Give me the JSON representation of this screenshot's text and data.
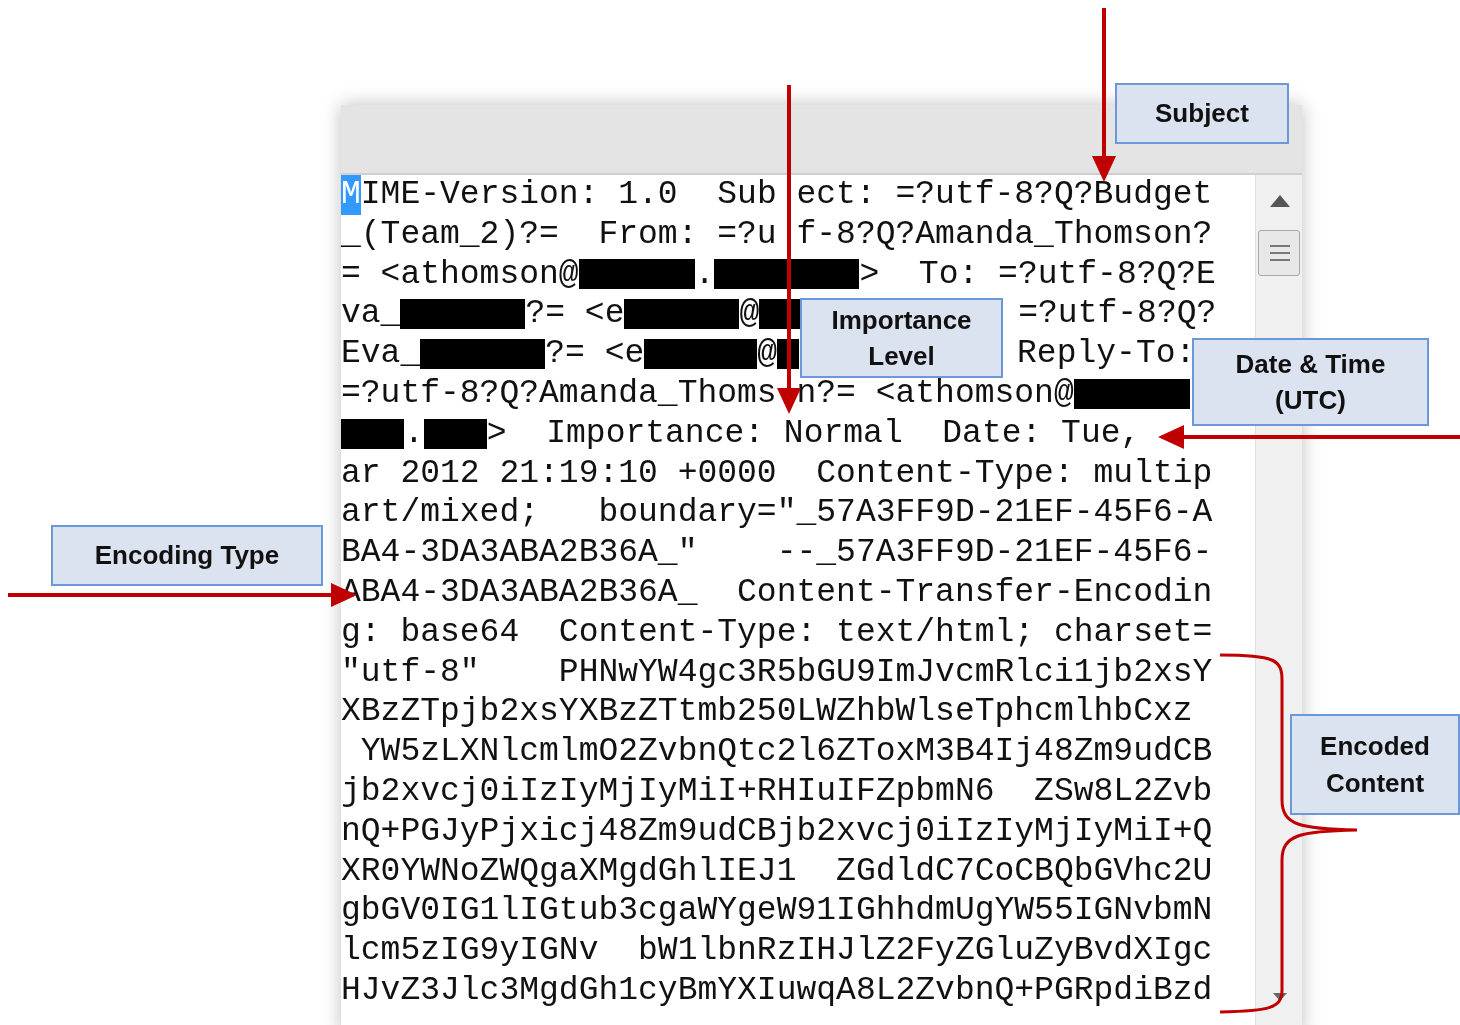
{
  "editor": {
    "lines": [
      {
        "segments": [
          {
            "text": "M",
            "highlighted": true
          },
          {
            "text": "IME-Version: 1.0  Sub",
            "highlighted": false
          },
          {
            "kind": "covered"
          },
          {
            "text": "ect: =?utf-8?Q?Budget"
          }
        ]
      },
      {
        "segments": [
          {
            "text": "_(Team_2)?=  From: =?u"
          },
          {
            "kind": "covered"
          },
          {
            "text": "f-8?Q?Amanda_Thomson?"
          }
        ]
      },
      {
        "segments": [
          {
            "text": "= <athomson@"
          },
          {
            "kind": "redacted"
          },
          {
            "text": "."
          },
          {
            "kind": "redacted"
          },
          {
            "text": ">  To: =?utf-8?Q?E"
          }
        ]
      },
      {
        "segments": [
          {
            "text": "va_"
          },
          {
            "kind": "redacted"
          },
          {
            "text": "?= <e"
          },
          {
            "kind": "redacted"
          },
          {
            "text": "@"
          },
          {
            "kind": "redacted"
          },
          {
            "kind": "hidden"
          },
          {
            "text": "=?utf-8?Q?"
          }
        ]
      },
      {
        "segments": [
          {
            "text": "Eva_"
          },
          {
            "kind": "redacted"
          },
          {
            "text": "?= <e"
          },
          {
            "kind": "redacted"
          },
          {
            "text": "@"
          },
          {
            "kind": "redacted"
          },
          {
            "kind": "hidden"
          },
          {
            "text": "Reply-To:"
          }
        ]
      },
      {
        "segments": [
          {
            "text": "=?utf-8?Q?Amanda_Thoms"
          },
          {
            "kind": "covered"
          },
          {
            "text": "n?= <athomson@"
          },
          {
            "kind": "redacted"
          }
        ]
      },
      {
        "segments": [
          {
            "kind": "redacted"
          },
          {
            "text": "."
          },
          {
            "kind": "redacted"
          },
          {
            "text": ">  Importance: Normal  Date: Tue,"
          }
        ]
      },
      {
        "segments": [
          {
            "text": "ar 2012 21:19:10 +0000  Content-Type: multip"
          }
        ]
      },
      {
        "segments": [
          {
            "text": "art/mixed;   boundary=\"_57A3FF9D-21EF-45F6-A"
          }
        ]
      },
      {
        "segments": [
          {
            "text": "BA4-3DA3ABA2B36A_\"    --_57A3FF9D-21EF-45F6-"
          }
        ]
      },
      {
        "segments": [
          {
            "text": "ABA4-3DA3ABA2B36A_  Content-Transfer-Encodin"
          }
        ]
      },
      {
        "segments": [
          {
            "text": "g: base64  Content-Type: text/html; charset="
          }
        ]
      },
      {
        "segments": [
          {
            "text": "\"utf-8\"    PHNwYW4gc3R5bGU9ImJvcmRlci1jb2xsY"
          }
        ]
      },
      {
        "segments": [
          {
            "text": "XBzZTpjb2xsYXBzZTtmb250LWZhbWlseTphcmlhbCxz"
          }
        ]
      },
      {
        "segments": [
          {
            "text": " YW5zLXNlcmlmO2ZvbnQtc2l6ZToxM3B4Ij48Zm9udCB"
          }
        ]
      },
      {
        "segments": [
          {
            "text": "jb2xvcj0iIzIyMjIyMiI+RHIuIFZpbmN6  ZSw8L2Zvb"
          }
        ]
      },
      {
        "segments": [
          {
            "text": "nQ+PGJyPjxicj48Zm9udCBjb2xvcj0iIzIyMjIyMiI+Q"
          }
        ]
      },
      {
        "segments": [
          {
            "text": "XR0YWNoZWQgaXMgdGhlIEJ1  ZGdldC7CoCBQbGVhc2U"
          }
        ]
      },
      {
        "segments": [
          {
            "text": "gbGV0IG1lIGtub3cgaWYgeW91IGhhdmUgYW55IGNvbmN"
          }
        ]
      },
      {
        "segments": [
          {
            "text": "lcm5zIG9yIGNv  bW1lbnRzIHJlZ2FyZGluZyBvdXIgc"
          }
        ]
      },
      {
        "segments": [
          {
            "text": "HJvZ3Jlc3MgdGh1cyBmYXIuwqA8L2ZvbnQ+PGRpdiBzd"
          }
        ]
      }
    ]
  },
  "callouts": [
    {
      "text": "Subject"
    },
    {
      "text": "Importance Level"
    },
    {
      "text": "Date & Time (UTC)"
    },
    {
      "text": "Encoding Type"
    },
    {
      "text": "Encoded Content"
    }
  ]
}
